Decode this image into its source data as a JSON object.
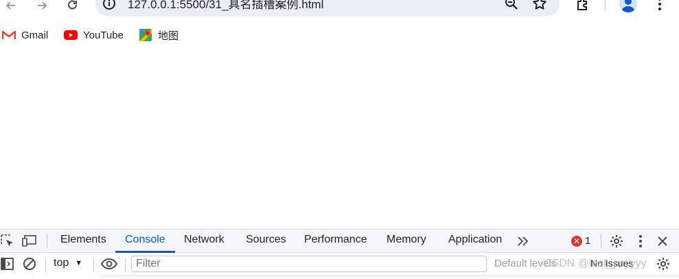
{
  "browser": {
    "url": "127.0.0.1:5500/31_具名插槽案例.html",
    "icons": [
      "back-icon",
      "forward-icon",
      "reload-icon",
      "site-info-icon",
      "zoom-icon",
      "bookmark-star-icon",
      "extensions-icon",
      "profile-icon",
      "menu-icon"
    ]
  },
  "bookmarks": [
    {
      "label": "Gmail",
      "icon": "gmail-icon"
    },
    {
      "label": "YouTube",
      "icon": "youtube-icon"
    },
    {
      "label": "地图",
      "icon": "maps-icon"
    }
  ],
  "devtools": {
    "tabs": [
      {
        "label": "Elements"
      },
      {
        "label": "Console"
      },
      {
        "label": "Network"
      },
      {
        "label": "Sources"
      },
      {
        "label": "Performance"
      },
      {
        "label": "Memory"
      },
      {
        "label": "Application"
      }
    ],
    "active_tab": "Console",
    "error_count": "1",
    "console": {
      "context": "top",
      "filter_placeholder": "Filter",
      "levels": "Default levels",
      "issues": "No Issues"
    },
    "accent_color": "#0b57d0",
    "error_color": "#dc362e"
  },
  "watermark": "CSDN @leaf_pcyyyy"
}
